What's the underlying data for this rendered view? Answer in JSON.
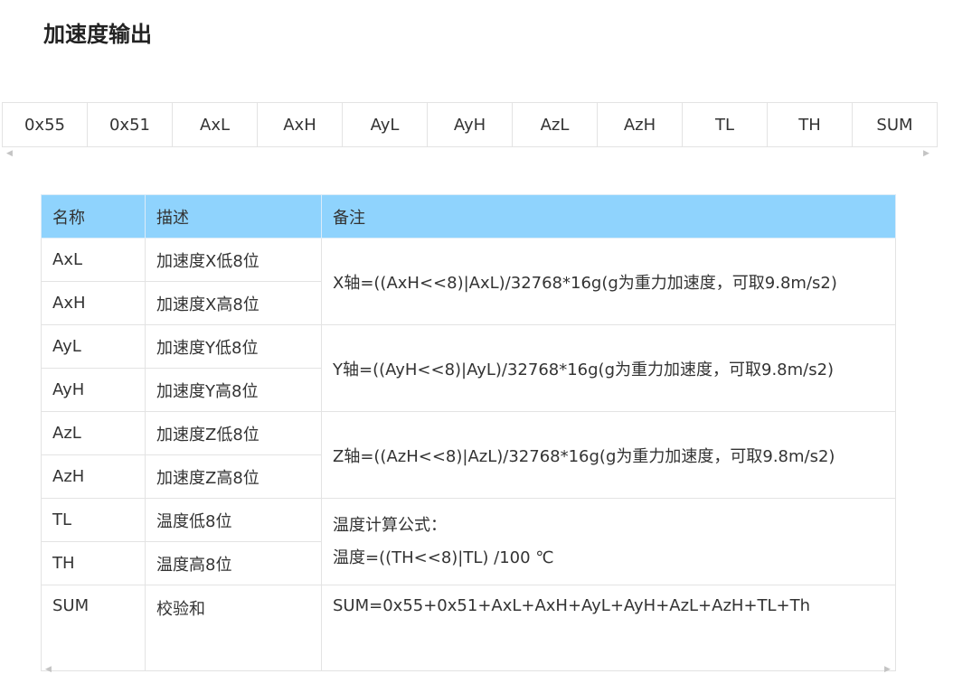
{
  "page": {
    "title": "加速度输出"
  },
  "frame": {
    "bytes": [
      "0x55",
      "0x51",
      "AxL",
      "AxH",
      "AyL",
      "AyH",
      "AzL",
      "AzH",
      "TL",
      "TH",
      "SUM"
    ]
  },
  "table": {
    "headers": {
      "name": "名称",
      "description": "描述",
      "note": "备注"
    },
    "rows": [
      {
        "name": "AxL",
        "description": "加速度X低8位"
      },
      {
        "name": "AxH",
        "description": "加速度X高8位"
      },
      {
        "name": "AyL",
        "description": "加速度Y低8位"
      },
      {
        "name": "AyH",
        "description": "加速度Y高8位"
      },
      {
        "name": "AzL",
        "description": "加速度Z低8位"
      },
      {
        "name": "AzH",
        "description": "加速度Z高8位"
      },
      {
        "name": "TL",
        "description": "温度低8位"
      },
      {
        "name": "TH",
        "description": "温度高8位"
      },
      {
        "name": "SUM",
        "description": "校验和"
      }
    ],
    "notes": {
      "x": "X轴=((AxH<<8)|AxL)/32768*16g(g为重力加速度，可取9.8m/s2)",
      "y": "Y轴=((AyH<<8)|AyL)/32768*16g(g为重力加速度，可取9.8m/s2)",
      "z": "Z轴=((AzH<<8)|AzL)/32768*16g(g为重力加速度，可取9.8m/s2)",
      "temp_title": "温度计算公式：",
      "temp_formula": "温度=((TH<<8)|TL) /100 ℃",
      "sum": "SUM=0x55+0x51+AxL+AxH+AyL+AyH+AzL+AzH+TL+Th"
    }
  },
  "icons": {
    "scroll_left": "◀",
    "scroll_right": "▶"
  }
}
